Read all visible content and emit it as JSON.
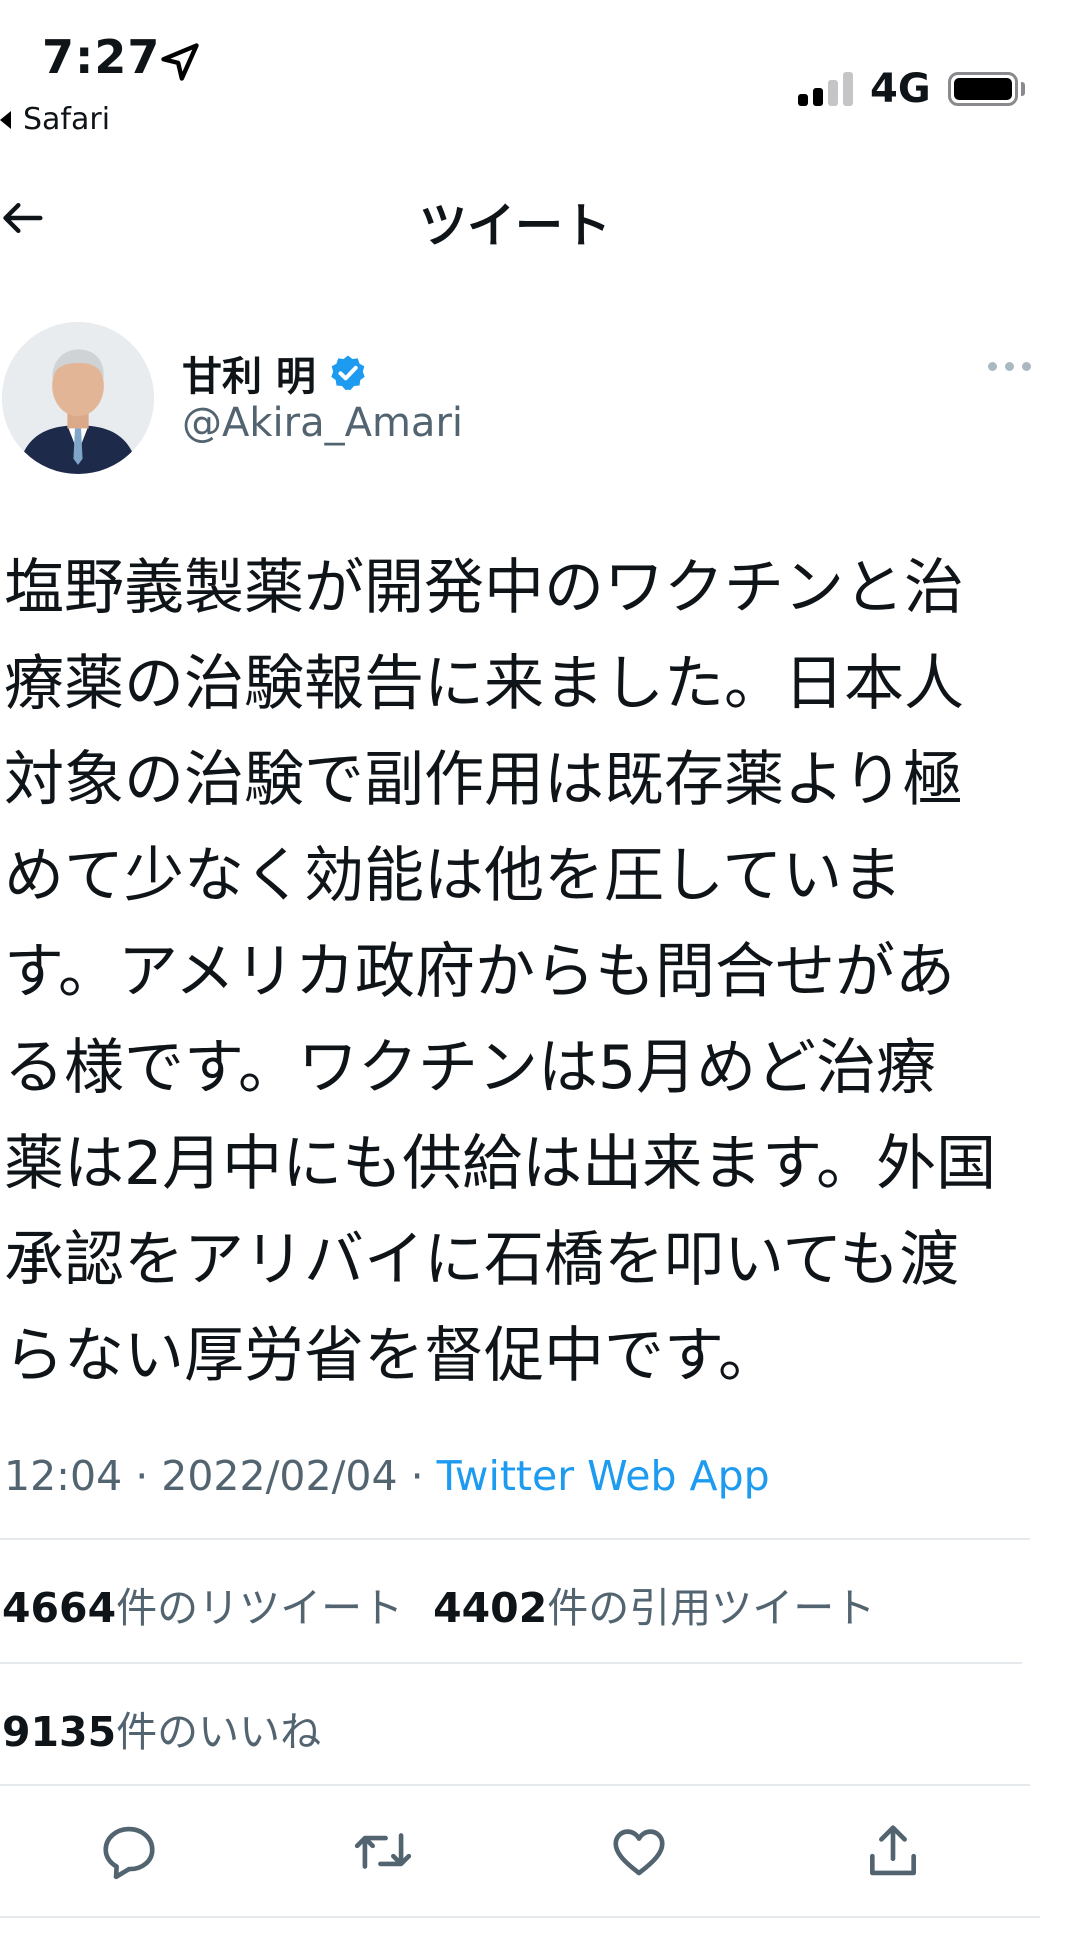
{
  "status_bar": {
    "time": "7:27",
    "back_app": "Safari",
    "network": "4G",
    "icons": [
      "location-arrow-icon",
      "signal-bars-icon",
      "battery-icon"
    ]
  },
  "header": {
    "title": "ツイート",
    "back_icon": "back-arrow-icon"
  },
  "author": {
    "display_name": "甘利 明",
    "handle": "@Akira_Amari",
    "verified": true
  },
  "tweet": {
    "lines": [
      "塩野義製薬が開発中のワクチンと治",
      "療薬の治験報告に来ました。日本人",
      "対象の治験で副作用は既存薬より極",
      "めて少なく効能は他を圧していま",
      "す。アメリカ政府からも問合せがあ",
      "る様です。ワクチンは5月めど治療",
      "薬は2月中にも供給は出来ます。外国",
      "承認をアリバイに石橋を叩いても渡",
      "らない厚労省を督促中です。"
    ],
    "timestamp": "12:04 · 2022/02/04 · ",
    "source": "Twitter Web App"
  },
  "stats": {
    "retweets_count": "4664",
    "retweets_label": "件のリツイート",
    "quotes_count": "4402",
    "quotes_label": "件の引用ツイート",
    "likes_count": "9135",
    "likes_label": "件のいいね"
  },
  "actions": [
    "reply-icon",
    "retweet-icon",
    "like-icon",
    "share-icon"
  ],
  "colors": {
    "text": "#0f1419",
    "secondary": "#536471",
    "link": "#1d9bf0",
    "verified": "#1d9bf0",
    "divider": "#e6e9ec"
  }
}
